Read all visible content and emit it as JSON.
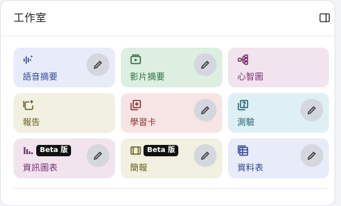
{
  "studio": {
    "title": "工作室",
    "cards": [
      {
        "label": "語音摘要",
        "icon": "audio-waveform-icon",
        "bg": "#e8ebf8",
        "fg": "#2f4696",
        "edit": true,
        "badge": ""
      },
      {
        "label": "影片摘要",
        "icon": "video-play-icon",
        "bg": "#dcefe1",
        "fg": "#2d6a3a",
        "edit": true,
        "badge": ""
      },
      {
        "label": "心智圖",
        "icon": "mind-map-icon",
        "bg": "#f1e4ef",
        "fg": "#7a2f6e",
        "edit": false,
        "badge": ""
      },
      {
        "label": "報告",
        "icon": "report-icon",
        "bg": "#f1f0e1",
        "fg": "#6b5a1e",
        "edit": false,
        "badge": ""
      },
      {
        "label": "學習卡",
        "icon": "flashcards-icon",
        "bg": "#f7e5e5",
        "fg": "#8a2b2b",
        "edit": true,
        "badge": ""
      },
      {
        "label": "測驗",
        "icon": "quiz-icon",
        "bg": "#def0f5",
        "fg": "#1f5f72",
        "edit": true,
        "badge": ""
      },
      {
        "label": "資訊圖表",
        "icon": "infographic-icon",
        "bg": "#f1e4ef",
        "fg": "#7a2f6e",
        "edit": true,
        "badge": "Beta 版"
      },
      {
        "label": "簡報",
        "icon": "slides-icon",
        "bg": "#f1f0e1",
        "fg": "#6b5a1e",
        "edit": true,
        "badge": "Beta 版"
      },
      {
        "label": "資料表",
        "icon": "data-table-icon",
        "bg": "#e8ebf8",
        "fg": "#2f4696",
        "edit": true,
        "badge": ""
      }
    ]
  },
  "colors": {
    "edit_button_bg": "#d4d7de",
    "badge_bg": "#111111"
  }
}
